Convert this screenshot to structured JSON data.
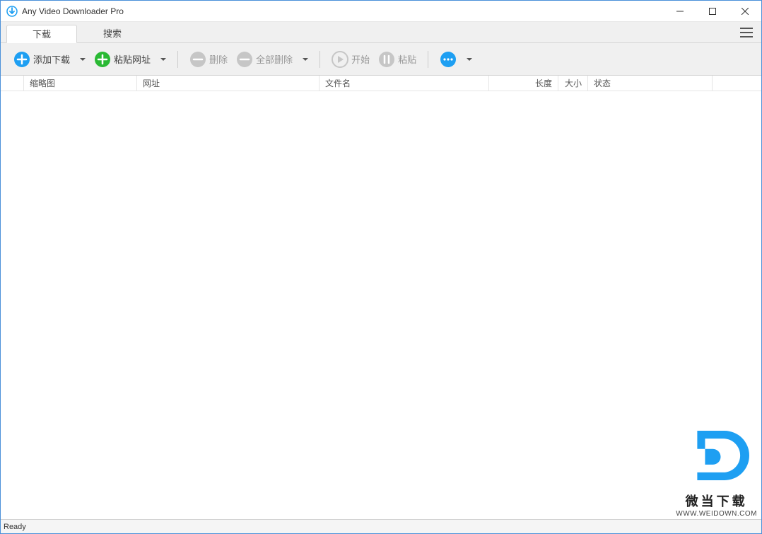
{
  "window": {
    "title": "Any Video Downloader Pro"
  },
  "tabs": {
    "download": "下载",
    "search": "搜索"
  },
  "toolbar": {
    "add_download": "添加下载",
    "paste_url": "粘贴网址",
    "delete": "删除",
    "delete_all": "全部删除",
    "start": "开始",
    "paste": "粘贴"
  },
  "columns": {
    "thumbnail": "缩略图",
    "url": "网址",
    "filename": "文件名",
    "length": "长度",
    "size": "大小",
    "status": "状态"
  },
  "statusbar": {
    "status": "Ready"
  },
  "watermark": {
    "name": "微当下载",
    "url": "WWW.WEIDOWN.COM"
  }
}
